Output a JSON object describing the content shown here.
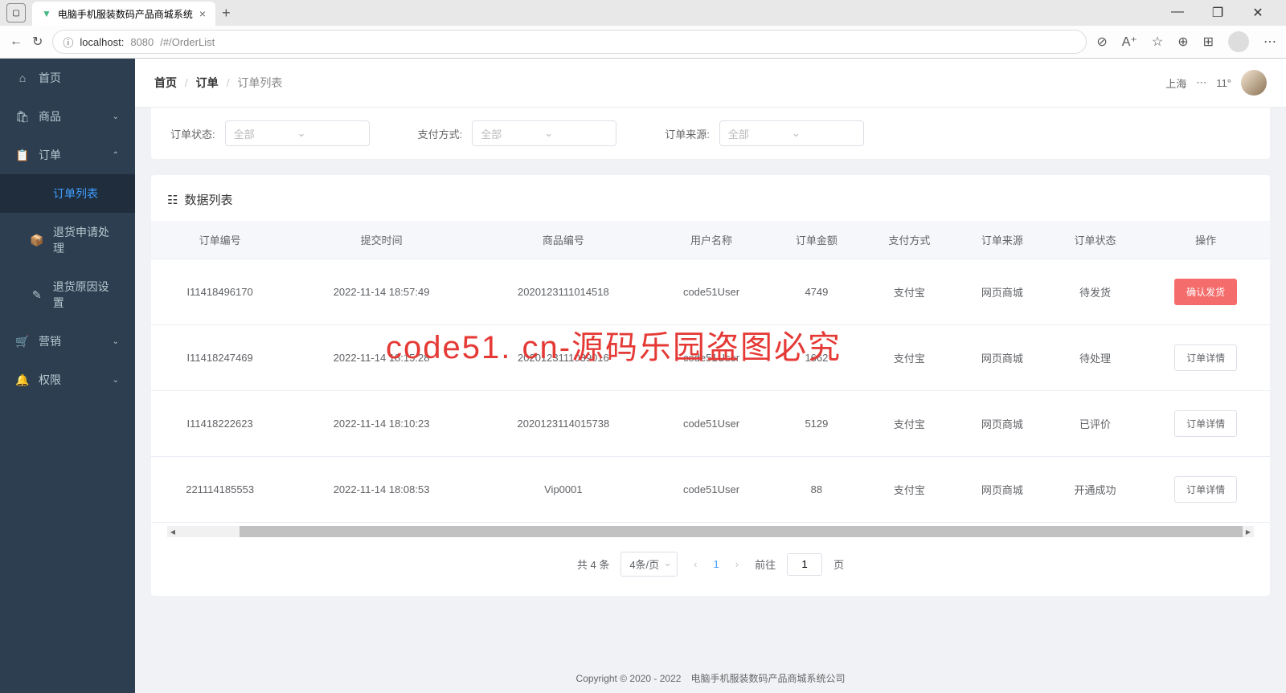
{
  "browser": {
    "tab_title": "电脑手机服装数码产品商城系统",
    "url_host": "localhost:",
    "url_port": "8080",
    "url_path": "/#/OrderList"
  },
  "sidebar": {
    "items": [
      {
        "icon": "⌂",
        "label": "首页"
      },
      {
        "icon": "🛍",
        "label": "商品",
        "arrow": "⌄"
      },
      {
        "icon": "📋",
        "label": "订单",
        "arrow": "⌃"
      },
      {
        "icon": "",
        "label": "订单列表",
        "sub": true,
        "active": true
      },
      {
        "icon": "📦",
        "label": "退货申请处理",
        "sub": true
      },
      {
        "icon": "✎",
        "label": "退货原因设置",
        "sub": true
      },
      {
        "icon": "🛒",
        "label": "营销",
        "arrow": "⌄"
      },
      {
        "icon": "🔔",
        "label": "权限",
        "arrow": "⌄"
      }
    ]
  },
  "breadcrumb": {
    "home": "首页",
    "sep1": "/",
    "order": "订单",
    "sep2": "/",
    "current": "订单列表"
  },
  "weather": {
    "city": "上海",
    "temp": "11°"
  },
  "filters": {
    "status_label": "订单状态:",
    "status_placeholder": "全部",
    "payment_label": "支付方式:",
    "payment_placeholder": "全部",
    "source_label": "订单来源:",
    "source_placeholder": "全部"
  },
  "table": {
    "title": "数据列表",
    "headers": [
      "订单编号",
      "提交时间",
      "商品编号",
      "用户名称",
      "订单金额",
      "支付方式",
      "订单来源",
      "订单状态",
      "操作"
    ],
    "rows": [
      {
        "id": "I11418496170",
        "time": "2022-11-14 18:57:49",
        "sku": "2020123111014518",
        "user": "code51User",
        "amount": "4749",
        "pay": "支付宝",
        "source": "网页商城",
        "status": "待发货",
        "action": "确认发货",
        "danger": true
      },
      {
        "id": "I11418247469",
        "time": "2022-11-14 18:15:28",
        "sku": "2020123111039016",
        "user": "code51User",
        "amount": "1662",
        "pay": "支付宝",
        "source": "网页商城",
        "status": "待处理",
        "action": "订单详情"
      },
      {
        "id": "I11418222623",
        "time": "2022-11-14 18:10:23",
        "sku": "2020123114015738",
        "user": "code51User",
        "amount": "5129",
        "pay": "支付宝",
        "source": "网页商城",
        "status": "已评价",
        "action": "订单详情"
      },
      {
        "id": "221114185553",
        "time": "2022-11-14 18:08:53",
        "sku": "Vip0001",
        "user": "code51User",
        "amount": "88",
        "pay": "支付宝",
        "source": "网页商城",
        "status": "开通成功",
        "action": "订单详情"
      }
    ]
  },
  "pagination": {
    "total": "共 4 条",
    "per_page": "4条/页",
    "current": "1",
    "goto_label": "前往",
    "goto_value": "1",
    "page_suffix": "页"
  },
  "footer": "Copyright © 2020 - 2022　电脑手机服装数码产品商城系统公司",
  "watermark": "code51. cn-源码乐园盗图必究"
}
